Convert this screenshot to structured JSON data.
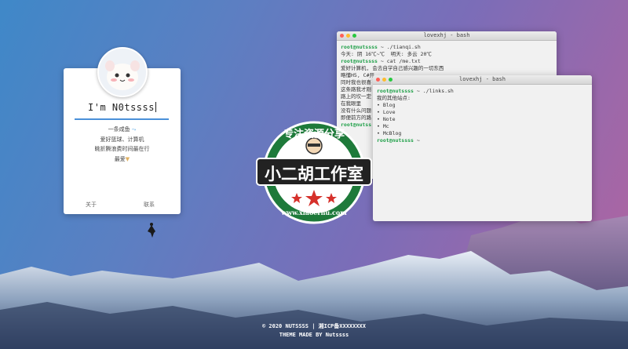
{
  "profile": {
    "name": "I'm N0tssss",
    "bio": [
      "一条咸鱼",
      "爱好篮球、计算机",
      "眺折腾浪费时间最在行",
      "最爱"
    ],
    "links": [
      "关于",
      "联系"
    ]
  },
  "terminal1": {
    "title": "lovexhj - bash",
    "lines": [
      {
        "prompt": "root@nutssss",
        "cmd": " ~ ./tianqi.sh"
      },
      {
        "text": "今天: 阴 16℃~℃  明天: 多云 20℃"
      },
      {
        "text": ""
      },
      {
        "prompt": "root@nutssss",
        "cmd": " ~ cat /me.txt"
      },
      {
        "text": "爱好计算机, 会去自学自己感兴趣的一切东西"
      },
      {
        "text": "略懂H5, C#开"
      },
      {
        "text": "同时我也很喜"
      },
      {
        "text": "这条路我才刚"
      },
      {
        "text": "路上的坎一定"
      },
      {
        "text": "在我眼里"
      },
      {
        "text": "没有什么问题"
      },
      {
        "text": "即便前方的路"
      },
      {
        "prompt": "root@nutss",
        "cmd": ""
      }
    ]
  },
  "terminal2": {
    "title": "lovexhj - bash",
    "lines": [
      {
        "prompt": "root@nutssss",
        "cmd": " ~ ./links.sh"
      },
      {
        "text": "我的其他站点:"
      },
      {
        "text": "• Blog"
      },
      {
        "text": "• Love"
      },
      {
        "text": "• Note"
      },
      {
        "text": "• Mc"
      },
      {
        "text": "• McBlog"
      },
      {
        "prompt": "root@nutssss",
        "cmd": " ~"
      }
    ]
  },
  "watermark": {
    "top": "专注资源分享",
    "middle": "小二胡工作室",
    "bottom": "www.xiaoerhu.com"
  },
  "footer": {
    "line1": "© 2020 NUTSSSS | 湘ICP备XXXXXXXX",
    "line2": "THEME MADE BY Nutssss"
  },
  "colors": {
    "prompt": "#1b9e45",
    "accent": "#4a90d9",
    "close": "#ff5f57",
    "minimize": "#febc2e",
    "maximize": "#28c840",
    "badge_green": "#1e7a3a",
    "badge_red": "#d6312b"
  }
}
